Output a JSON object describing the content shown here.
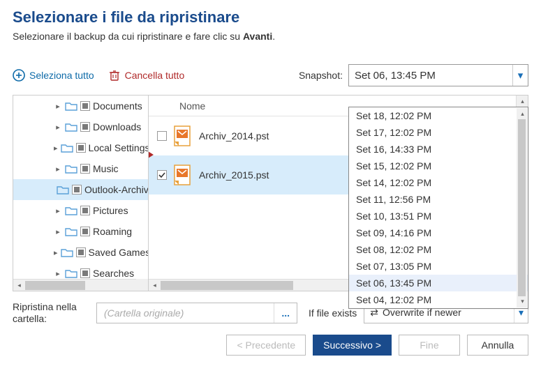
{
  "header": {
    "title": "Selezionare i file da ripristinare",
    "subtitle_before": "Selezionare il backup da cui ripristinare e fare clic su ",
    "subtitle_bold": "Avanti",
    "subtitle_after": "."
  },
  "toolbar": {
    "select_all": "Seleziona tutto",
    "clear_all": "Cancella tutto",
    "snapshot_label": "Snapshot:",
    "snapshot_value": "Set 06, 13:45 PM"
  },
  "tree": {
    "items": [
      {
        "label": "Documents",
        "expander": "▸",
        "selected": false,
        "partial": true
      },
      {
        "label": "Downloads",
        "expander": "▸",
        "selected": false,
        "partial": true
      },
      {
        "label": "Local Settings",
        "expander": "▸",
        "selected": false,
        "partial": true
      },
      {
        "label": "Music",
        "expander": "▸",
        "selected": false,
        "partial": true
      },
      {
        "label": "Outlook-Archiv",
        "expander": "",
        "selected": true,
        "partial": true
      },
      {
        "label": "Pictures",
        "expander": "▸",
        "selected": false,
        "partial": true
      },
      {
        "label": "Roaming",
        "expander": "▸",
        "selected": false,
        "partial": true
      },
      {
        "label": "Saved Games",
        "expander": "▸",
        "selected": false,
        "partial": true
      },
      {
        "label": "Searches",
        "expander": "▸",
        "selected": false,
        "partial": true
      }
    ]
  },
  "list": {
    "header": "Nome",
    "rows": [
      {
        "name": "Archiv_2014.pst",
        "checked": false,
        "selected": false
      },
      {
        "name": "Archiv_2015.pst",
        "checked": true,
        "selected": true
      }
    ]
  },
  "snapshot_dropdown": {
    "items": [
      "Set 18, 12:02 PM",
      "Set 17, 12:02 PM",
      "Set 16, 14:33 PM",
      "Set 15, 12:02 PM",
      "Set 14, 12:02 PM",
      "Set 11, 12:56 PM",
      "Set 10, 13:51 PM",
      "Set 09, 14:16 PM",
      "Set 08, 12:02 PM",
      "Set 07, 13:05 PM",
      "Set 06, 13:45 PM",
      "Set 04, 12:02 PM"
    ],
    "selected_index": 10
  },
  "restore": {
    "label": "Ripristina nella cartella:",
    "placeholder": "(Cartella originale)",
    "if_exists_label": "If file exists",
    "if_exists_value": "Overwrite if newer"
  },
  "footer": {
    "prev": "< Precedente",
    "next": "Successivo >",
    "finish": "Fine",
    "cancel": "Annulla"
  }
}
